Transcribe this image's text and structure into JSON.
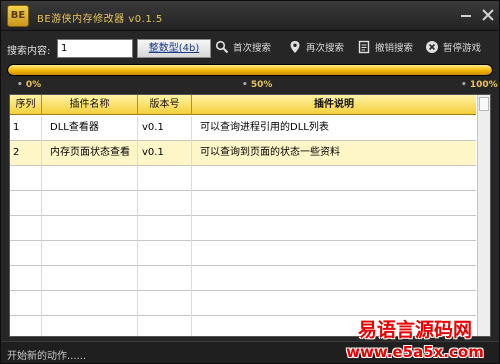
{
  "window": {
    "icon_text": "BE",
    "title": "BE游侠内存修改器 v0.1.5"
  },
  "search": {
    "label": "搜索内容:",
    "value": "1",
    "type_button": "整数型(4b)",
    "actions": {
      "first_search": "首次搜索",
      "next_search": "再次搜索",
      "undo_search": "撤销搜索",
      "pause_game": "暂停游戏"
    }
  },
  "progress": {
    "value_percent": 100,
    "labels": [
      "0%",
      "50%",
      "100%"
    ]
  },
  "table": {
    "columns": [
      "序列",
      "插件名称",
      "版本号",
      "插件说明"
    ],
    "rows": [
      {
        "seq": "1",
        "name": "DLL查看器",
        "version": "v0.1",
        "desc": "可以查询进程引用的DLL列表"
      },
      {
        "seq": "2",
        "name": "内存页面状态查看",
        "version": "v0.1",
        "desc": "可以查询到页面的状态一些资料"
      }
    ],
    "empty_rows": 7
  },
  "status": {
    "text": "开始新的动作......"
  },
  "watermark": {
    "title": "易语言源码网",
    "url": "www.e5a5x.com"
  },
  "colors": {
    "accent": "#f2b600",
    "header_bg": "#f4cf3a",
    "title_text": "#e8c35a",
    "watermark": "#e60000"
  },
  "icons": {
    "first_search": "search-icon",
    "next_search": "location-pin-icon",
    "undo_search": "undo-document-icon",
    "pause_game": "close-circle-icon"
  }
}
